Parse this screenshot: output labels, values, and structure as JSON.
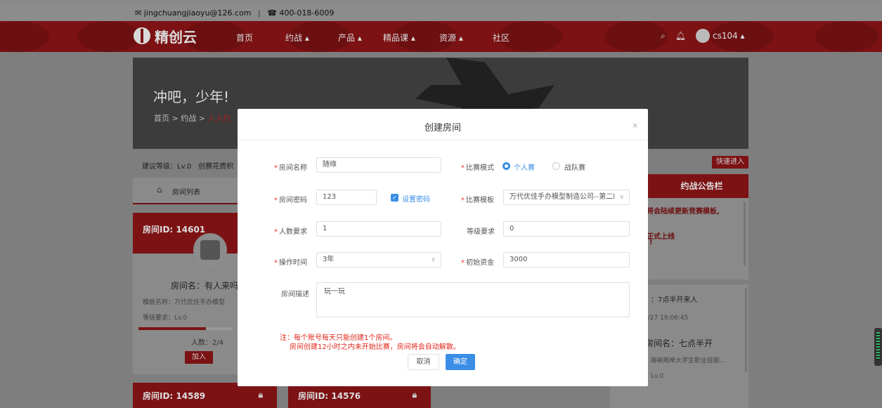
{
  "contact": {
    "email": "jingchuangjiaoyu@126.com",
    "separator": "|",
    "phone": "400-018-6009",
    "mail_icon": "mail-icon",
    "phone_icon": "phone-icon"
  },
  "nav": {
    "brand": "精创云",
    "items": [
      "首页",
      "约战 ▴",
      "产品 ▴",
      "精品课 ▴",
      "资源 ▴",
      "社区"
    ],
    "user": "cs104 ▴",
    "icons": [
      "search-icon",
      "bell-icon",
      "avatar"
    ]
  },
  "banner": {
    "title": "冲吧，少年!",
    "crumb_home": "首页",
    "crumb_sep1": ">",
    "crumb_battle": "约战",
    "crumb_sep2": ">",
    "crumb_current": "人人约"
  },
  "filter": {
    "text": "建议等级：Lv.0　创赛花费积"
  },
  "fast_enter": "快速进入",
  "tab": {
    "label": "房间列表"
  },
  "rooms": [
    {
      "id": "房间ID: 14601",
      "name": "房间名：有人来吗",
      "template": "模板名称：万代优佳手办模型",
      "level": "等级要求：Lv.0",
      "count": "人数：2/4",
      "join": "加入",
      "progress": 0.72
    },
    {
      "id": "房间ID: 14589"
    },
    {
      "id": "房间ID: 14576"
    }
  ],
  "notice": {
    "title": "约战公告栏",
    "line1": "将会陆续更新竞赛模板,",
    "line2": "正式上线",
    "line3": "!"
  },
  "right_card": {
    "t1": "：7点半开来人",
    "t2": "2/27 19:06:45",
    "t3": "房间名：七点半开",
    "t4": "：海峡两岸大学生职业技能...",
    "t5": "等级要求：Lv.0"
  },
  "modal": {
    "title": "创建房间",
    "close": "×",
    "room_name_label": "房间名称",
    "room_name_value": "随缘",
    "mode_label": "比赛模式",
    "mode_personal": "个人赛",
    "mode_team": "战队赛",
    "password_label": "房间密码",
    "password_value": "123",
    "set_password_label": "设置密码",
    "template_label": "比赛模板",
    "template_value": "万代优佳手办模型制造公司--第二l",
    "people_label": "人数要求",
    "people_value": "1",
    "level_label": "等级要求",
    "level_value": "0",
    "time_label": "操作时间",
    "time_value": "3年",
    "funds_label": "初始资金",
    "funds_value": "3000",
    "desc_label": "房间描述",
    "desc_value": "玩一玩",
    "note1": "注：每个账号每天只能创建1个房间。",
    "note2": "房间创建12小时之内未开始比赛，房间将会自动解散。",
    "cancel": "取消",
    "confirm": "确定"
  },
  "colors": {
    "accent": "#3a8ee6",
    "brand_red": "#c8232a",
    "required": "#e33333"
  }
}
